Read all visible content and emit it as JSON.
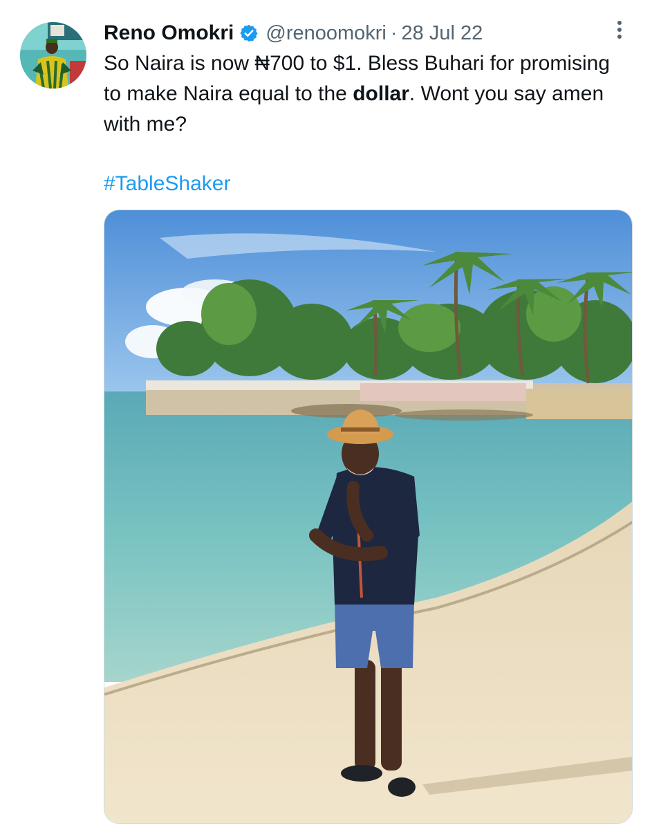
{
  "tweet": {
    "author": {
      "display_name": "Reno Omokri",
      "handle": "@renoomokri",
      "verified": true,
      "avatar_icon": "profile-photo"
    },
    "separator": "·",
    "date": "28 Jul 22",
    "more_icon": "three-dots-vertical-icon",
    "text": {
      "line_part1": "So Naira is now ₦700 to $1. Bless Buhari for promising to make Naira equal to the ",
      "bold_word": "dollar",
      "line_part2": ". Wont you say amen with me?"
    },
    "hashtag": "#TableShaker",
    "media": {
      "type": "photo",
      "icon": "beach-photo"
    }
  },
  "colors": {
    "text_primary": "#0f1419",
    "text_secondary": "#536471",
    "link": "#1d9bf0",
    "verified_badge": "#1d9bf0"
  }
}
